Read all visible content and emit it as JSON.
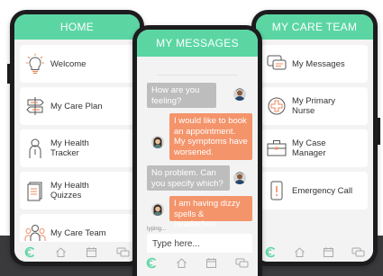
{
  "home": {
    "title": "HOME",
    "items": [
      {
        "label": "Welcome",
        "icon": "lightbulb-icon"
      },
      {
        "label": "My Care Plan",
        "icon": "signpost-icon"
      },
      {
        "label": "My Health Tracker",
        "icon": "person-icon"
      },
      {
        "label": "My Health Quizzes",
        "icon": "document-icon"
      },
      {
        "label": "My Care Team",
        "icon": "group-icon"
      }
    ]
  },
  "messages": {
    "title": "MY MESSAGES",
    "bubbles": [
      {
        "text": "How are you feeling?",
        "from": "nurse"
      },
      {
        "text": "I would like to book an appointment. My symptoms have worsened.",
        "from": "patient"
      },
      {
        "text": "No problem. Can you specify which?",
        "from": "nurse"
      },
      {
        "text": "I am having dizzy spells & headaches",
        "from": "patient"
      }
    ],
    "typing": "typing...",
    "input_placeholder": "Type here..."
  },
  "team": {
    "title": "MY CARE TEAM",
    "items": [
      {
        "label": "My Messages",
        "icon": "chat-icon"
      },
      {
        "label": "My Primary Nurse",
        "icon": "medical-cross-icon"
      },
      {
        "label": "My Case Manager",
        "icon": "briefcase-icon"
      },
      {
        "label": "Emergency Call",
        "icon": "phone-alert-icon"
      }
    ]
  },
  "colors": {
    "accent": "#5bd6a3",
    "grey_bubble": "#bdbdbd",
    "orange_bubble": "#f4946b",
    "icon_orange": "#f08a5d"
  }
}
